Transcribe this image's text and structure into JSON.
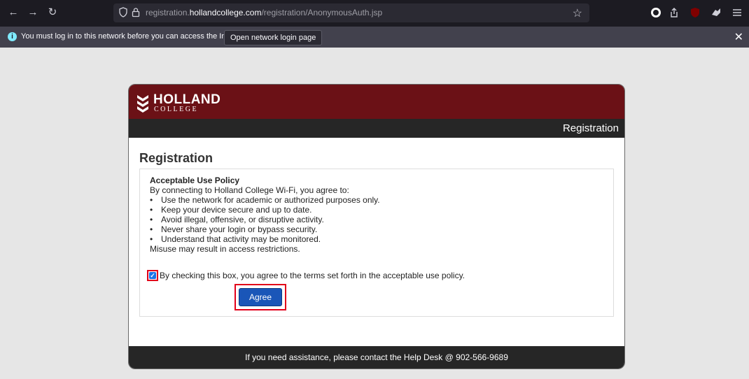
{
  "browser": {
    "url_prefix": "registration.",
    "url_domain": "hollandcollege.com",
    "url_path": "/registration/AnonymousAuth.jsp",
    "icons": [
      "back-icon",
      "forward-icon",
      "reload-icon",
      "shield-icon",
      "lock-icon",
      "star-icon",
      "extension-icon",
      "share-icon",
      "ublock-icon",
      "puzzle-icon",
      "menu-icon"
    ]
  },
  "notification": {
    "message": "You must log in to this network before you can access the Internet.",
    "button_label": "Open network login page"
  },
  "card": {
    "brand_line1": "HOLLAND",
    "brand_line2": "COLLEGE",
    "header_title": "Registration",
    "page_title": "Registration",
    "policy": {
      "heading": "Acceptable Use Policy",
      "intro": "By connecting to Holland College Wi-Fi, you agree to:",
      "items": [
        "Use the network for academic or authorized purposes only.",
        "Keep your device secure and up to date.",
        "Avoid illegal, offensive, or disruptive activity.",
        "Never share your login or bypass security.",
        "Understand that activity may be monitored."
      ],
      "outro": "Misuse may result in access restrictions."
    },
    "checkbox_label": "By checking this box, you agree to the terms set forth in the acceptable use policy.",
    "checkbox_checked": true,
    "agree_label": "Agree",
    "footer": "If you need assistance, please contact the Help Desk @ 902-566-9689"
  },
  "colors": {
    "header": "#6b1116",
    "bar": "#262626",
    "button": "#1a56b8",
    "highlight": "#e2001a"
  }
}
